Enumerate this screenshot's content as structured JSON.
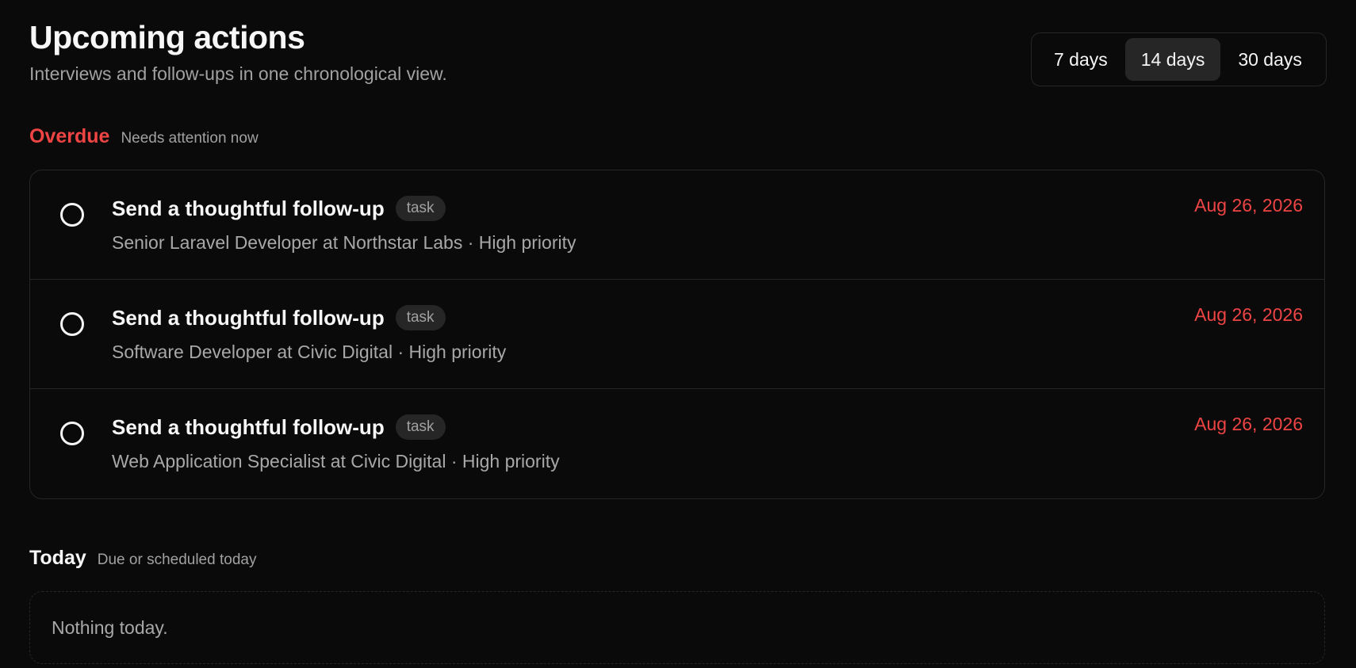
{
  "header": {
    "title": "Upcoming actions",
    "subtitle": "Interviews and follow-ups in one chronological view."
  },
  "range": {
    "options": [
      "7 days",
      "14 days",
      "30 days"
    ],
    "selected": "14 days"
  },
  "overdue": {
    "title": "Overdue",
    "note": "Needs attention now",
    "items": [
      {
        "title": "Send a thoughtful follow-up",
        "badge": "task",
        "subtitle": "Senior Laravel Developer at Northstar Labs · High priority",
        "date": "Aug 26, 2026"
      },
      {
        "title": "Send a thoughtful follow-up",
        "badge": "task",
        "subtitle": "Software Developer at Civic Digital · High priority",
        "date": "Aug 26, 2026"
      },
      {
        "title": "Send a thoughtful follow-up",
        "badge": "task",
        "subtitle": "Web Application Specialist at Civic Digital · High priority",
        "date": "Aug 26, 2026"
      }
    ]
  },
  "today": {
    "title": "Today",
    "note": "Due or scheduled today",
    "empty": "Nothing today."
  },
  "colors": {
    "background": "#0a0a0a",
    "overdue_accent": "#ef4444",
    "muted_text": "#a1a1a1",
    "border": "#262626"
  }
}
